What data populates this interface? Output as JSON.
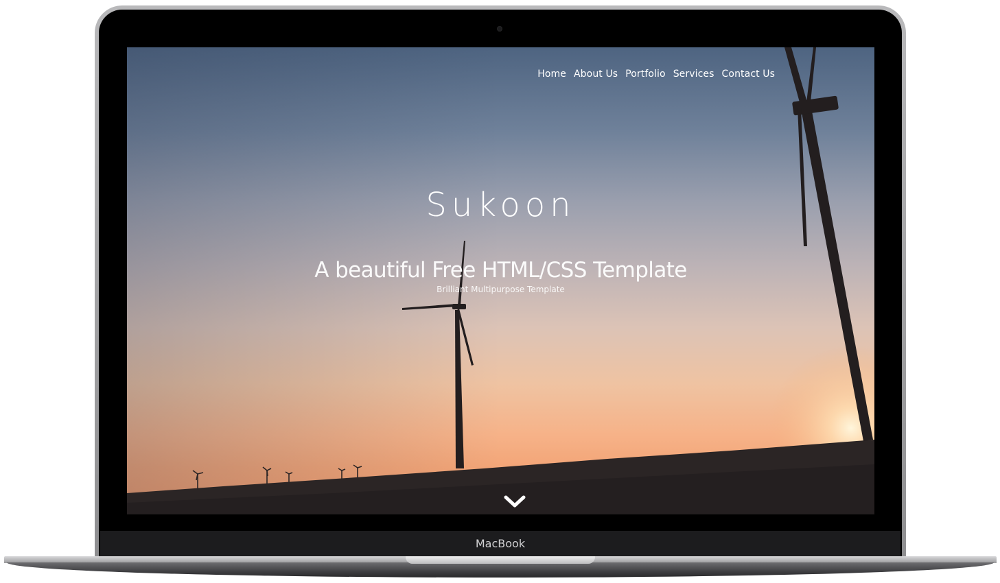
{
  "device": {
    "label": "MacBook"
  },
  "nav": {
    "items": [
      {
        "label": "Home"
      },
      {
        "label": "About Us"
      },
      {
        "label": "Portfolio"
      },
      {
        "label": "Services"
      },
      {
        "label": "Contact Us"
      }
    ]
  },
  "hero": {
    "title": "Sukoon",
    "subtitle": "A beautiful Free HTML/CSS Template",
    "tagline": "Brilliant Multipurpose Template",
    "scroll_icon": "chevron-down-icon"
  },
  "colors": {
    "sky_top": "#4e6481",
    "sky_bottom": "#f19a6a",
    "silhouette": "#231e1f",
    "text": "#ffffff"
  }
}
